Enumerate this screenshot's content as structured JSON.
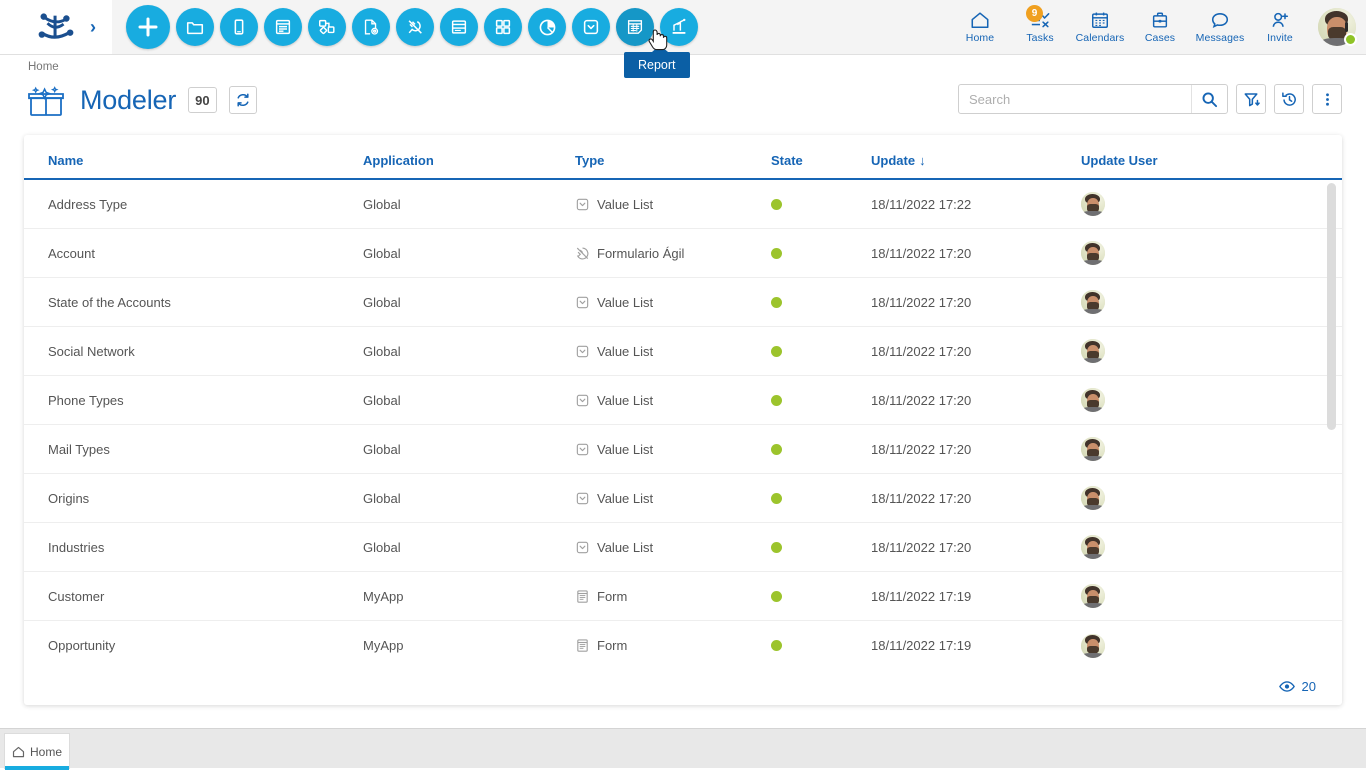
{
  "topbar": {
    "logo_name": "deyel-logo",
    "expand_label": "›",
    "app_icons": [
      {
        "name": "add-icon",
        "title": "New"
      },
      {
        "name": "folder-icon",
        "title": "Folder"
      },
      {
        "name": "mobile-icon",
        "title": "Mobile"
      },
      {
        "name": "form-list-icon",
        "title": "Form"
      },
      {
        "name": "process-icon",
        "title": "Process"
      },
      {
        "name": "doc-config-icon",
        "title": "Document"
      },
      {
        "name": "plug-icon",
        "title": "Connector"
      },
      {
        "name": "page-layout-icon",
        "title": "Page"
      },
      {
        "name": "grid-icon",
        "title": "Dashboard"
      },
      {
        "name": "pie-chart-icon",
        "title": "Chart"
      },
      {
        "name": "dropdown-box-icon",
        "title": "Value List"
      },
      {
        "name": "report-icon",
        "title": "Report"
      },
      {
        "name": "rule-icon",
        "title": "Rule"
      }
    ],
    "tooltip": "Report",
    "right_nav": [
      {
        "name": "home",
        "label": "Home",
        "icon": "home-icon",
        "badge": ""
      },
      {
        "name": "tasks",
        "label": "Tasks",
        "icon": "tasks-icon",
        "badge": "9"
      },
      {
        "name": "calendars",
        "label": "Calendars",
        "icon": "calendar-icon",
        "badge": ""
      },
      {
        "name": "cases",
        "label": "Cases",
        "icon": "briefcase-icon",
        "badge": ""
      },
      {
        "name": "messages",
        "label": "Messages",
        "icon": "chat-icon",
        "badge": ""
      },
      {
        "name": "invite",
        "label": "Invite",
        "icon": "user-add-icon",
        "badge": ""
      }
    ]
  },
  "breadcrumb": "Home",
  "header": {
    "title": "Modeler",
    "count": "90",
    "refresh_icon": "refresh-icon",
    "title_icon": "modeler-box-icon"
  },
  "search": {
    "placeholder": "Search",
    "value": "",
    "search_icon": "search-icon",
    "filter_icon": "filter-down-icon",
    "history_icon": "history-icon",
    "more_icon": "more-vertical-icon"
  },
  "table": {
    "columns": [
      {
        "key": "name",
        "label": "Name",
        "sorted": false
      },
      {
        "key": "app",
        "label": "Application",
        "sorted": false
      },
      {
        "key": "type",
        "label": "Type",
        "sorted": false
      },
      {
        "key": "state",
        "label": "State",
        "sorted": false
      },
      {
        "key": "upd",
        "label": "Update",
        "sorted": true,
        "sort_arrow": "↓"
      },
      {
        "key": "user",
        "label": "Update User",
        "sorted": false
      }
    ],
    "rows": [
      {
        "name": "Address Type",
        "app": "Global",
        "type": "Value List",
        "type_icon": "value-list-icon",
        "state": "active",
        "update": "18/11/2022 17:22",
        "user": "avatar"
      },
      {
        "name": "Account",
        "app": "Global",
        "type": "Formulario Ágil",
        "type_icon": "agile-form-icon",
        "state": "active",
        "update": "18/11/2022 17:20",
        "user": "avatar"
      },
      {
        "name": "State of the Accounts",
        "app": "Global",
        "type": "Value List",
        "type_icon": "value-list-icon",
        "state": "active",
        "update": "18/11/2022 17:20",
        "user": "avatar"
      },
      {
        "name": "Social Network",
        "app": "Global",
        "type": "Value List",
        "type_icon": "value-list-icon",
        "state": "active",
        "update": "18/11/2022 17:20",
        "user": "avatar"
      },
      {
        "name": "Phone Types",
        "app": "Global",
        "type": "Value List",
        "type_icon": "value-list-icon",
        "state": "active",
        "update": "18/11/2022 17:20",
        "user": "avatar"
      },
      {
        "name": "Mail Types",
        "app": "Global",
        "type": "Value List",
        "type_icon": "value-list-icon",
        "state": "active",
        "update": "18/11/2022 17:20",
        "user": "avatar"
      },
      {
        "name": "Origins",
        "app": "Global",
        "type": "Value List",
        "type_icon": "value-list-icon",
        "state": "active",
        "update": "18/11/2022 17:20",
        "user": "avatar"
      },
      {
        "name": "Industries",
        "app": "Global",
        "type": "Value List",
        "type_icon": "value-list-icon",
        "state": "active",
        "update": "18/11/2022 17:20",
        "user": "avatar"
      },
      {
        "name": "Customer",
        "app": "MyApp",
        "type": "Form",
        "type_icon": "form-icon",
        "state": "active",
        "update": "18/11/2022 17:19",
        "user": "avatar"
      },
      {
        "name": "Opportunity",
        "app": "MyApp",
        "type": "Form",
        "type_icon": "form-icon",
        "state": "active",
        "update": "18/11/2022 17:19",
        "user": "avatar"
      }
    ],
    "footer_count": "20",
    "footer_icon": "eye-icon"
  },
  "taskbar": {
    "tab_label": "Home",
    "tab_icon": "home-outline-icon"
  },
  "colors": {
    "accent_blue": "#1665b5",
    "cyan": "#18ace0",
    "state_green": "#9cc42c",
    "badge_orange": "#f0a020",
    "tooltip_blue": "#0b5fa5"
  }
}
